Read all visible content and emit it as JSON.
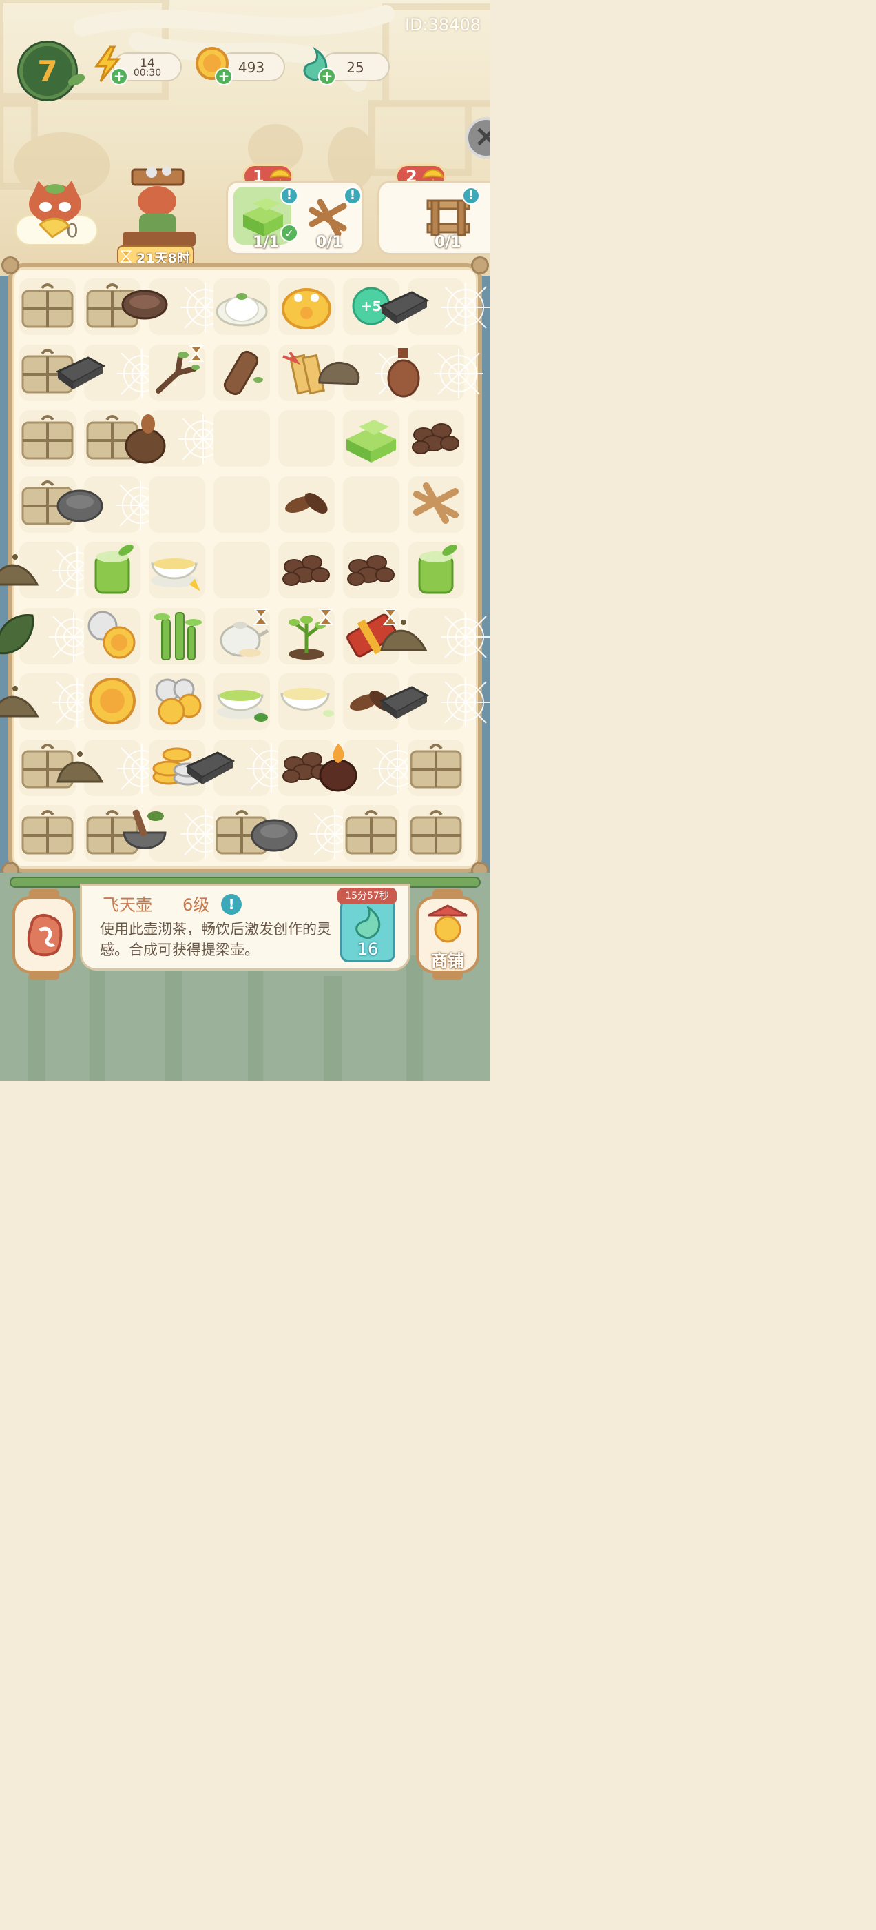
{
  "header": {
    "user_id": "ID:38408",
    "player_level": "7",
    "energy": {
      "value": "14",
      "timer": "00:30"
    },
    "coins": {
      "value": "493"
    },
    "gems": {
      "value": "25"
    }
  },
  "character": {
    "ginkgo_count": "0",
    "event_timer": "21天8时"
  },
  "orders": [
    {
      "number": "1",
      "items": [
        {
          "icon": "green-tea-cake-icon",
          "count": "1/1",
          "done": true
        },
        {
          "icon": "woven-mat-icon",
          "count": "0/1",
          "done": false
        }
      ]
    },
    {
      "number": "2",
      "items": [
        {
          "icon": "wooden-rack-icon",
          "count": "0/1",
          "done": false
        }
      ]
    }
  ],
  "board": {
    "rows": [
      [
        "bundle",
        "bundle",
        "webbed-bowl",
        "steamed-bun",
        "golden-toad",
        "plus5-gem",
        "webbed-inkstone"
      ],
      [
        "bundle",
        "webbed-inkstone",
        "branch-timer",
        "wood-log",
        "scrolls",
        "webbed-rock",
        "webbed-bottle"
      ],
      [
        "bundle",
        "bundle",
        "webbed-gourd",
        "empty",
        "empty",
        "green-tea-cake",
        "tea-pile"
      ],
      [
        "bundle",
        "webbed-stone",
        "empty",
        "empty",
        "leaves",
        "empty",
        "woven-mat"
      ],
      [
        "webbed-mound",
        "bamboo-cup",
        "tea-soup",
        "empty",
        "tea-pile",
        "tea-pile",
        "bamboo-cup"
      ],
      [
        "webbed-leaf",
        "silver-gold-coins",
        "bamboo",
        "teapot-timer",
        "sapling-timer",
        "red-box-timer",
        "webbed-mound"
      ],
      [
        "webbed-mound",
        "gold-coin",
        "coin-pile",
        "green-tea-bowl",
        "tea-bowl",
        "leaves",
        "webbed-inkstone"
      ],
      [
        "bundle",
        "webbed-mound",
        "coin-stack",
        "webbed-inkstone",
        "tea-pile",
        "webbed-flame-pot",
        "bundle"
      ],
      [
        "bundle",
        "bundle",
        "webbed-mortar",
        "bundle",
        "webbed-stone",
        "bundle",
        "bundle"
      ]
    ]
  },
  "info_panel": {
    "title": "飞天壶",
    "level": "6级",
    "description": "使用此壶沏茶，畅饮后激发创作的灵感。合成可获得提梁壶。",
    "producer_timer": "15分57秒",
    "producer_count": "16"
  },
  "shop": {
    "label": "商铺"
  },
  "colors": {
    "accent": "#3d6b3a",
    "order_head": "#d9574c",
    "board_frame": "#c6a87a"
  }
}
